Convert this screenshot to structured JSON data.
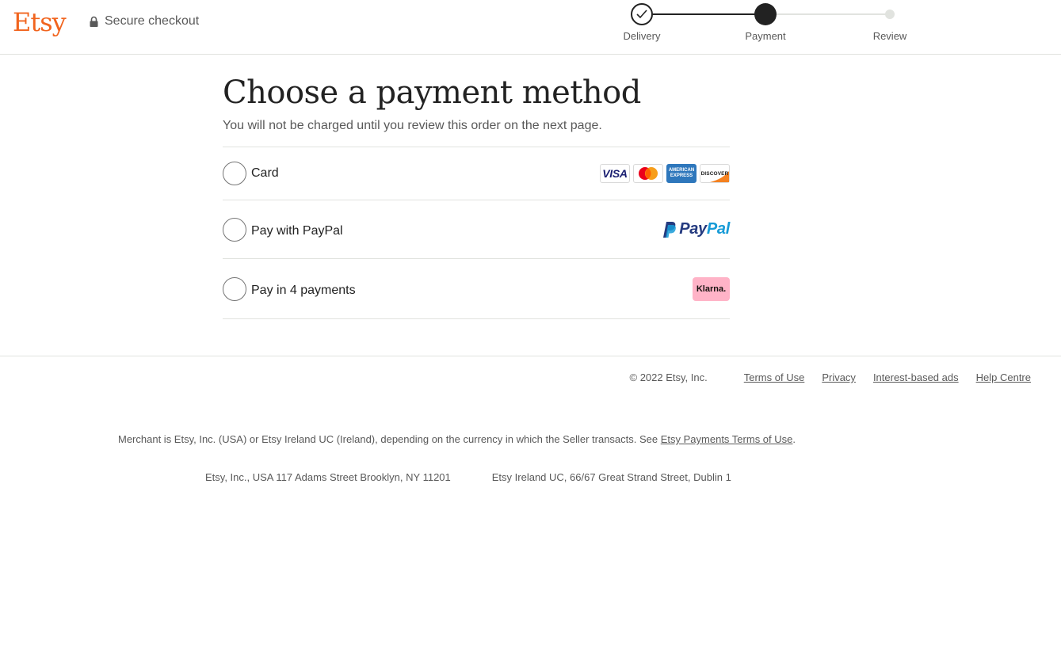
{
  "header": {
    "logo": "Etsy",
    "secure_label": "Secure checkout"
  },
  "progress": {
    "steps": [
      {
        "label": "Delivery",
        "state": "complete"
      },
      {
        "label": "Payment",
        "state": "current"
      },
      {
        "label": "Review",
        "state": "upcoming"
      }
    ]
  },
  "main": {
    "title": "Choose a payment method",
    "subtitle": "You will not be charged until you review this order on the next page.",
    "options": [
      {
        "label": "Card",
        "selected": false,
        "logos": [
          "visa-icon",
          "mastercard-icon",
          "amex-icon",
          "discover-icon"
        ]
      },
      {
        "label": "Pay with PayPal",
        "selected": false,
        "logos": [
          "paypal-logo"
        ]
      },
      {
        "label": "Pay in 4 payments",
        "selected": false,
        "logos": [
          "klarna-logo"
        ]
      }
    ],
    "card_logos": {
      "visa": "VISA",
      "amex": "AMERICAN EXPRESS",
      "discover": "DISCOVER"
    },
    "paypal_logo": {
      "pay": "Pay",
      "pal": "Pal"
    },
    "klarna_logo": "Klarna."
  },
  "footer": {
    "copyright": "© 2022 Etsy, Inc.",
    "links": [
      "Terms of Use",
      "Privacy",
      "Interest-based ads",
      "Help Centre"
    ],
    "merchant_text": "Merchant is Etsy, Inc. (USA) or Etsy Ireland UC (Ireland), depending on the currency in which the Seller transacts. See ",
    "merchant_link": "Etsy Payments Terms of Use",
    "merchant_end": ".",
    "address_us": "Etsy, Inc., USA 117 Adams Street Brooklyn, NY 11201",
    "address_ie": "Etsy Ireland UC, 66/67 Great Strand Street, Dublin 1"
  },
  "colors": {
    "brand": "#f1641e",
    "text": "#222222",
    "muted": "#595959",
    "border": "#e1e3df",
    "klarna": "#ffb3c7"
  }
}
